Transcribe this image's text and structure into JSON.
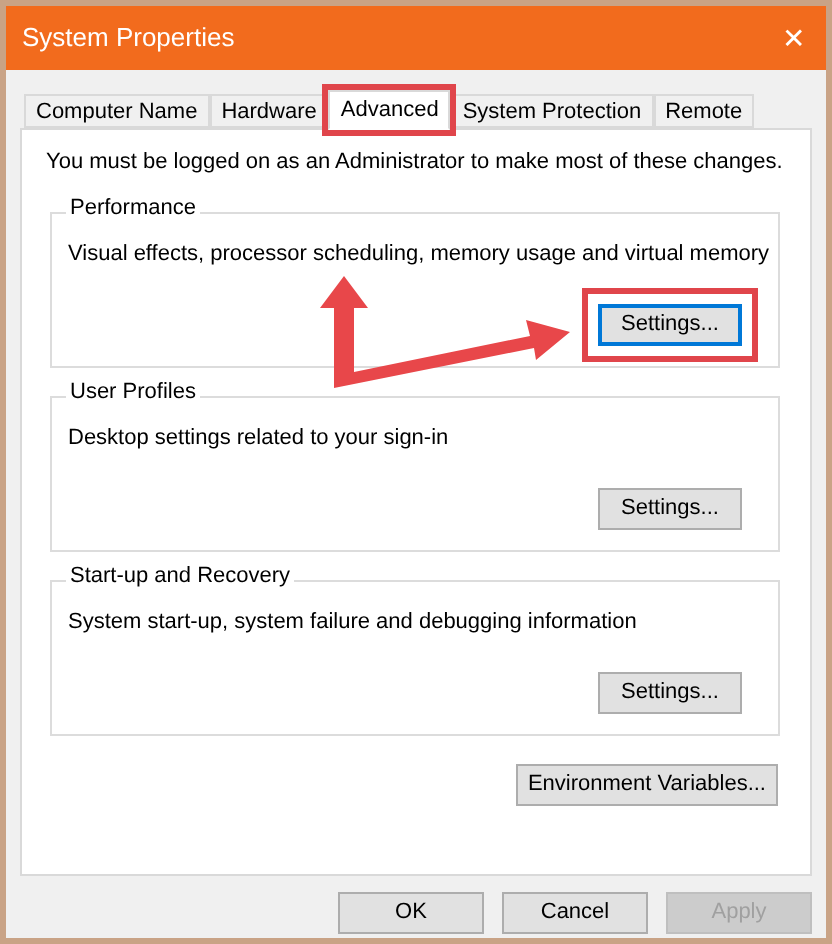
{
  "window": {
    "title": "System Properties",
    "close": "✕"
  },
  "tabs": [
    {
      "label": "Computer Name",
      "selected": false,
      "highlighted": false
    },
    {
      "label": "Hardware",
      "selected": false,
      "highlighted": false
    },
    {
      "label": "Advanced",
      "selected": true,
      "highlighted": true
    },
    {
      "label": "System Protection",
      "selected": false,
      "highlighted": false
    },
    {
      "label": "Remote",
      "selected": false,
      "highlighted": false
    }
  ],
  "notice": "You must be logged on as an Administrator to make most of these changes.",
  "groups": [
    {
      "title": "Performance",
      "description": "Visual effects, processor scheduling, memory usage and virtual memory",
      "button": {
        "label": "Settings...",
        "default": true,
        "highlighted": true
      }
    },
    {
      "title": "User Profiles",
      "description": "Desktop settings related to your sign-in",
      "button": {
        "label": "Settings...",
        "default": false,
        "highlighted": false
      }
    },
    {
      "title": "Start-up and Recovery",
      "description": "System start-up, system failure and debugging information",
      "button": {
        "label": "Settings...",
        "default": false,
        "highlighted": false
      }
    }
  ],
  "environment_button": "Environment Variables...",
  "buttons": [
    {
      "label": "OK",
      "disabled": false
    },
    {
      "label": "Cancel",
      "disabled": false
    },
    {
      "label": "Apply",
      "disabled": true
    }
  ]
}
